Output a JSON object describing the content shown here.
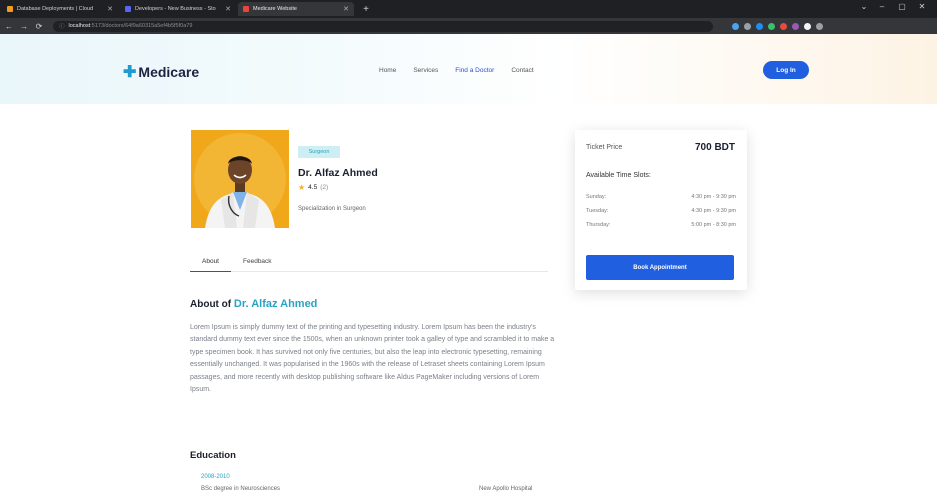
{
  "browser": {
    "tabs": [
      {
        "title": "Database Deployments | Cloud",
        "favicon_color": "#f39b1c",
        "active": false
      },
      {
        "title": "Developers - New Business - Sto",
        "favicon_color": "#5865f2",
        "active": false
      },
      {
        "title": "Medicare Website",
        "favicon_color": "#e8453c",
        "active": true
      }
    ],
    "new_tab": "+",
    "window_controls": [
      "⌄",
      "–",
      "▢",
      "✕"
    ],
    "url_host": "localhost",
    "url_path": ":5173/doctors/64f9a60315a5ef4b5f5f0a79",
    "extension_colors": [
      "#4aa3f0",
      "#9aa0a6",
      "#1f8ef1",
      "#35c46b",
      "#e84b3c",
      "#9b59b6",
      "#f5f5f5",
      "#9aa0a6"
    ]
  },
  "header": {
    "logo_text": "Medicare",
    "nav": [
      {
        "label": "Home",
        "active": false
      },
      {
        "label": "Services",
        "active": false
      },
      {
        "label": "Find a Doctor",
        "active": true
      },
      {
        "label": "Contact",
        "active": false
      }
    ],
    "login_label": "Log In"
  },
  "doctor": {
    "specialty": "Surgeon",
    "name": "Dr. Alfaz Ahmed",
    "rating": "4.5",
    "rating_count": "(2)",
    "specialization": "Specialization in Surgeon"
  },
  "profile_tabs": [
    {
      "label": "About",
      "active": true
    },
    {
      "label": "Feedback",
      "active": false
    }
  ],
  "about": {
    "heading_prefix": "About of",
    "heading_name": "Dr. Alfaz Ahmed",
    "text": "Lorem Ipsum is simply dummy text of the printing and typesetting industry. Lorem Ipsum has been the industry's standard dummy text ever since the 1500s, when an unknown printer took a galley of type and scrambled it to make a type specimen book. It has survived not only five centuries, but also the leap into electronic typesetting, remaining essentially unchanged. It was popularised in the 1960s with the release of Letraset sheets containing Lorem Ipsum passages, and more recently with desktop publishing software like Aldus PageMaker including versions of Lorem Ipsum."
  },
  "education": {
    "heading": "Education",
    "entries": [
      {
        "years": "2008-2010",
        "degree": "BSc degree in Neurosciences",
        "place": "New Apollo Hospital"
      }
    ]
  },
  "ticket": {
    "price_label": "Ticket Price",
    "price_value": "700 BDT",
    "slots_heading": "Available Time Slots:",
    "slots": [
      {
        "day": "Sunday:",
        "time": "4:30 pm - 9:30 pm"
      },
      {
        "day": "Tuesday:",
        "time": "4:30 pm - 9:30 pm"
      },
      {
        "day": "Thursday:",
        "time": "5:00 pm - 8:30 pm"
      }
    ],
    "book_label": "Book Appointment"
  },
  "colors": {
    "primary": "#1f5fe0",
    "accent": "#29a3c2",
    "star": "#f3b21b",
    "photo_bg": "#f0a81a"
  }
}
